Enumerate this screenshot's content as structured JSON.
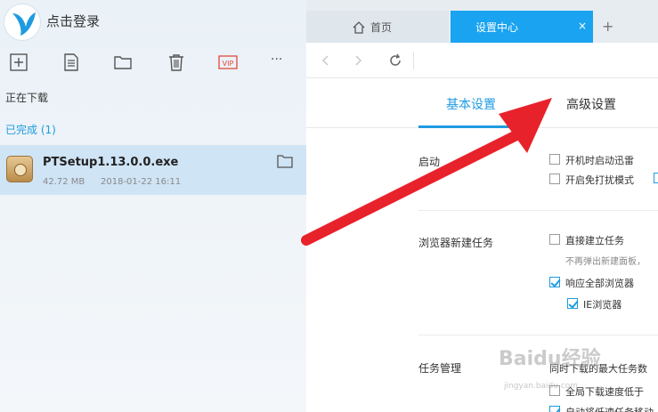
{
  "sidebar": {
    "login_text": "点击登录",
    "toolbar": [
      "new-task-icon",
      "document-icon",
      "folder-icon",
      "trash-icon",
      "vip-icon",
      "more-icon"
    ],
    "vip_label": "VIP",
    "more_label": "···",
    "downloading_label": "正在下载",
    "completed_label": "已完成 (1)",
    "file": {
      "name": "PTSetup1.13.0.0.exe",
      "size": "42.72 MB",
      "date": "2018-01-22 16:11"
    }
  },
  "tabs": {
    "home": "首页",
    "settings": "设置中心",
    "close": "×",
    "add": "+"
  },
  "settings": {
    "tab_basic": "基本设置",
    "tab_advanced": "高级设置",
    "startup": {
      "label": "启动",
      "options": [
        "开机时启动迅雷",
        "开启免打扰模式"
      ]
    },
    "browser": {
      "label": "浏览器新建任务",
      "direct": "直接建立任务",
      "direct_hint": "不再弹出新建面板，",
      "respond_all": "响应全部浏览器",
      "ie": "IE浏览器"
    },
    "task": {
      "label": "任务管理",
      "max_tasks": "同时下载的最大任务数",
      "speed": "全局下载速度低于",
      "auto": "自动将低速任务移动"
    }
  },
  "watermark": {
    "brand": "Baidu经验",
    "url": "jingyan.baidu.com"
  },
  "colors": {
    "accent": "#1e9be0",
    "arrow": "#e8222a",
    "selected_row": "#cfe4f5"
  }
}
